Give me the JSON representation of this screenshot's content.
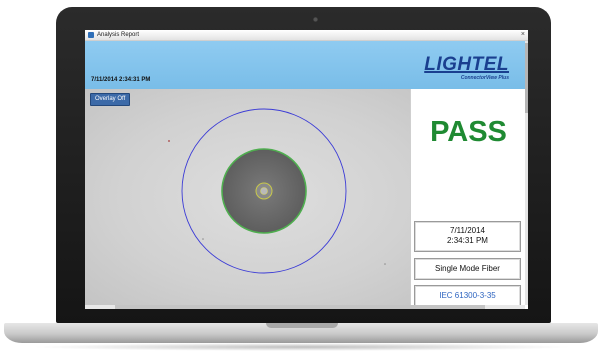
{
  "window": {
    "title": "Analysis Report",
    "close_glyph": "×"
  },
  "header": {
    "timestamp": "7/11/2014 2:34:31 PM",
    "brand_name": "LIGHTEL",
    "brand_sub": "ConnectorView Plus"
  },
  "image_pane": {
    "overlay_button": "Overlay Off"
  },
  "result": {
    "status": "PASS",
    "status_color": "#1f8a32",
    "date": "7/11/2014",
    "time": "2:34:31 PM",
    "fiber_mode": "Single Mode Fiber",
    "standard": "IEC 61300-3-35"
  },
  "icons": {
    "app": "app-icon",
    "close": "close-icon",
    "camera": "webcam"
  }
}
